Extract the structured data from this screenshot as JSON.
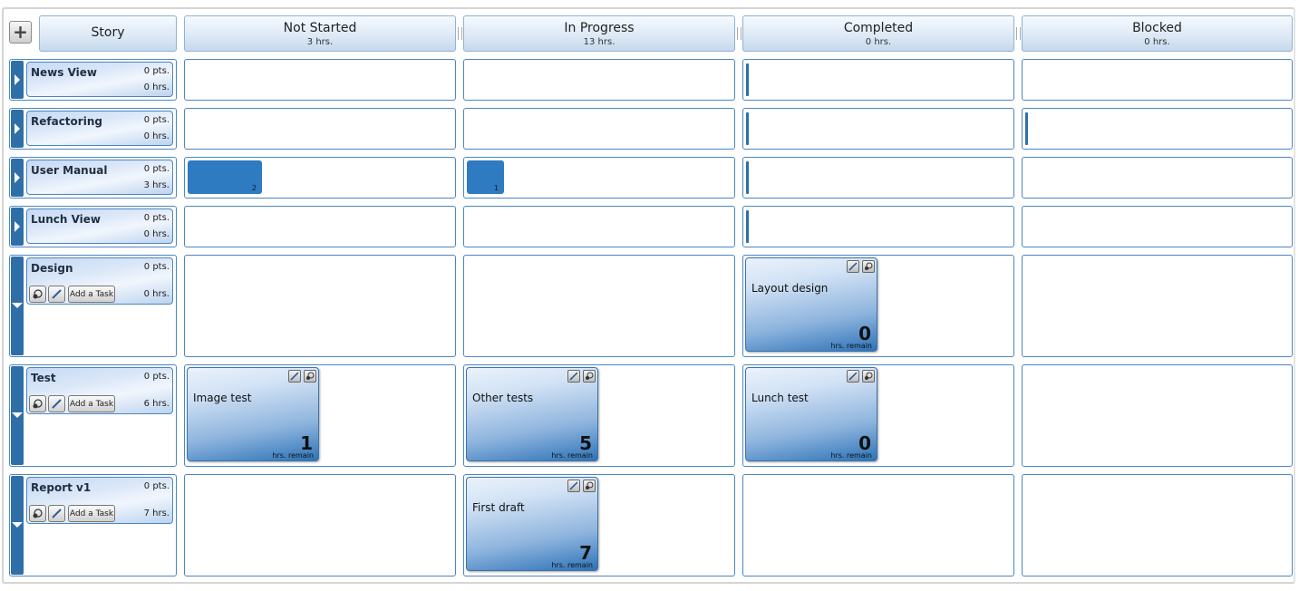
{
  "header": {
    "story_label": "Story",
    "columns": [
      {
        "title": "Not Started",
        "hours": "3 hrs."
      },
      {
        "title": "In Progress",
        "hours": "13 hrs."
      },
      {
        "title": "Completed",
        "hours": "0 hrs."
      },
      {
        "title": "Blocked",
        "hours": "0 hrs."
      }
    ]
  },
  "add_task_label": "Add a Task",
  "task_hrs_label": "hrs. remain",
  "stories": [
    {
      "name": "News View",
      "points": "0 pts.",
      "hours": "0 hrs.",
      "expanded": false
    },
    {
      "name": "Refactoring",
      "points": "0 pts.",
      "hours": "0 hrs.",
      "expanded": false
    },
    {
      "name": "User Manual",
      "points": "0 pts.",
      "hours": "3 hrs.",
      "expanded": false,
      "mini_tasks": {
        "not_started": "2",
        "in_progress": "1"
      }
    },
    {
      "name": "Lunch View",
      "points": "0 pts.",
      "hours": "0 hrs.",
      "expanded": false
    },
    {
      "name": "Design",
      "points": "0 pts.",
      "hours": "0 hrs.",
      "expanded": true,
      "tasks": {
        "completed": {
          "name": "Layout design",
          "remain": "0"
        }
      }
    },
    {
      "name": "Test",
      "points": "0 pts.",
      "hours": "6 hrs.",
      "expanded": true,
      "tasks": {
        "not_started": {
          "name": "Image test",
          "remain": "1"
        },
        "in_progress": {
          "name": "Other tests",
          "remain": "5"
        },
        "completed": {
          "name": "Lunch test",
          "remain": "0"
        }
      }
    },
    {
      "name": "Report v1",
      "points": "0 pts.",
      "hours": "7 hrs.",
      "expanded": true,
      "tasks": {
        "in_progress": {
          "name": "First draft",
          "remain": "7"
        }
      }
    }
  ],
  "colors": {
    "accent": "#2f6fa8",
    "cell_border": "#4a86c0",
    "header_bg": "#dbe8f5"
  },
  "icons": [
    "plus-icon",
    "expand-arrow-icon",
    "collapse-arrow-icon",
    "pencil-icon",
    "paint-icon"
  ]
}
